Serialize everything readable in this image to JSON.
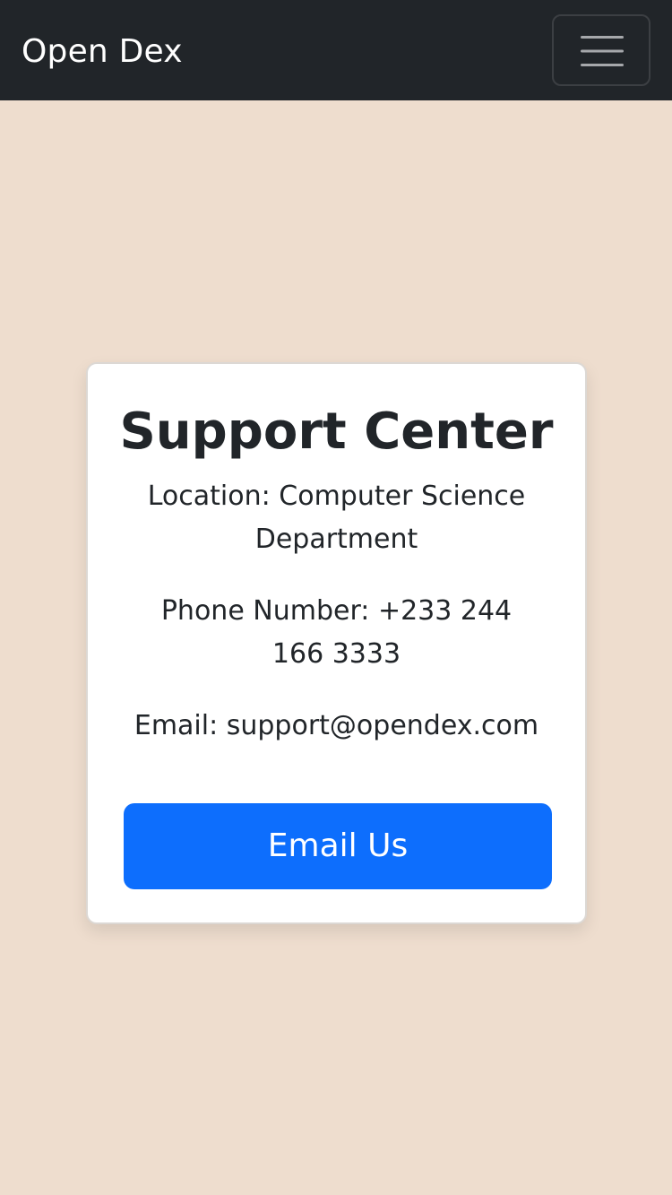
{
  "navbar": {
    "brand": "Open Dex",
    "toggler_icon": "hamburger-menu-icon"
  },
  "support_card": {
    "title": "Support Center",
    "location": "Location: Computer Science Department",
    "phone": "Phone Number: +233 244 166 3333",
    "email": "Email: support@opendex.com",
    "button_label": "Email Us"
  },
  "colors": {
    "background": "#eeddce",
    "navbar": "#212529",
    "card": "#ffffff",
    "primary_button": "#0d6efd",
    "text": "#212529"
  }
}
